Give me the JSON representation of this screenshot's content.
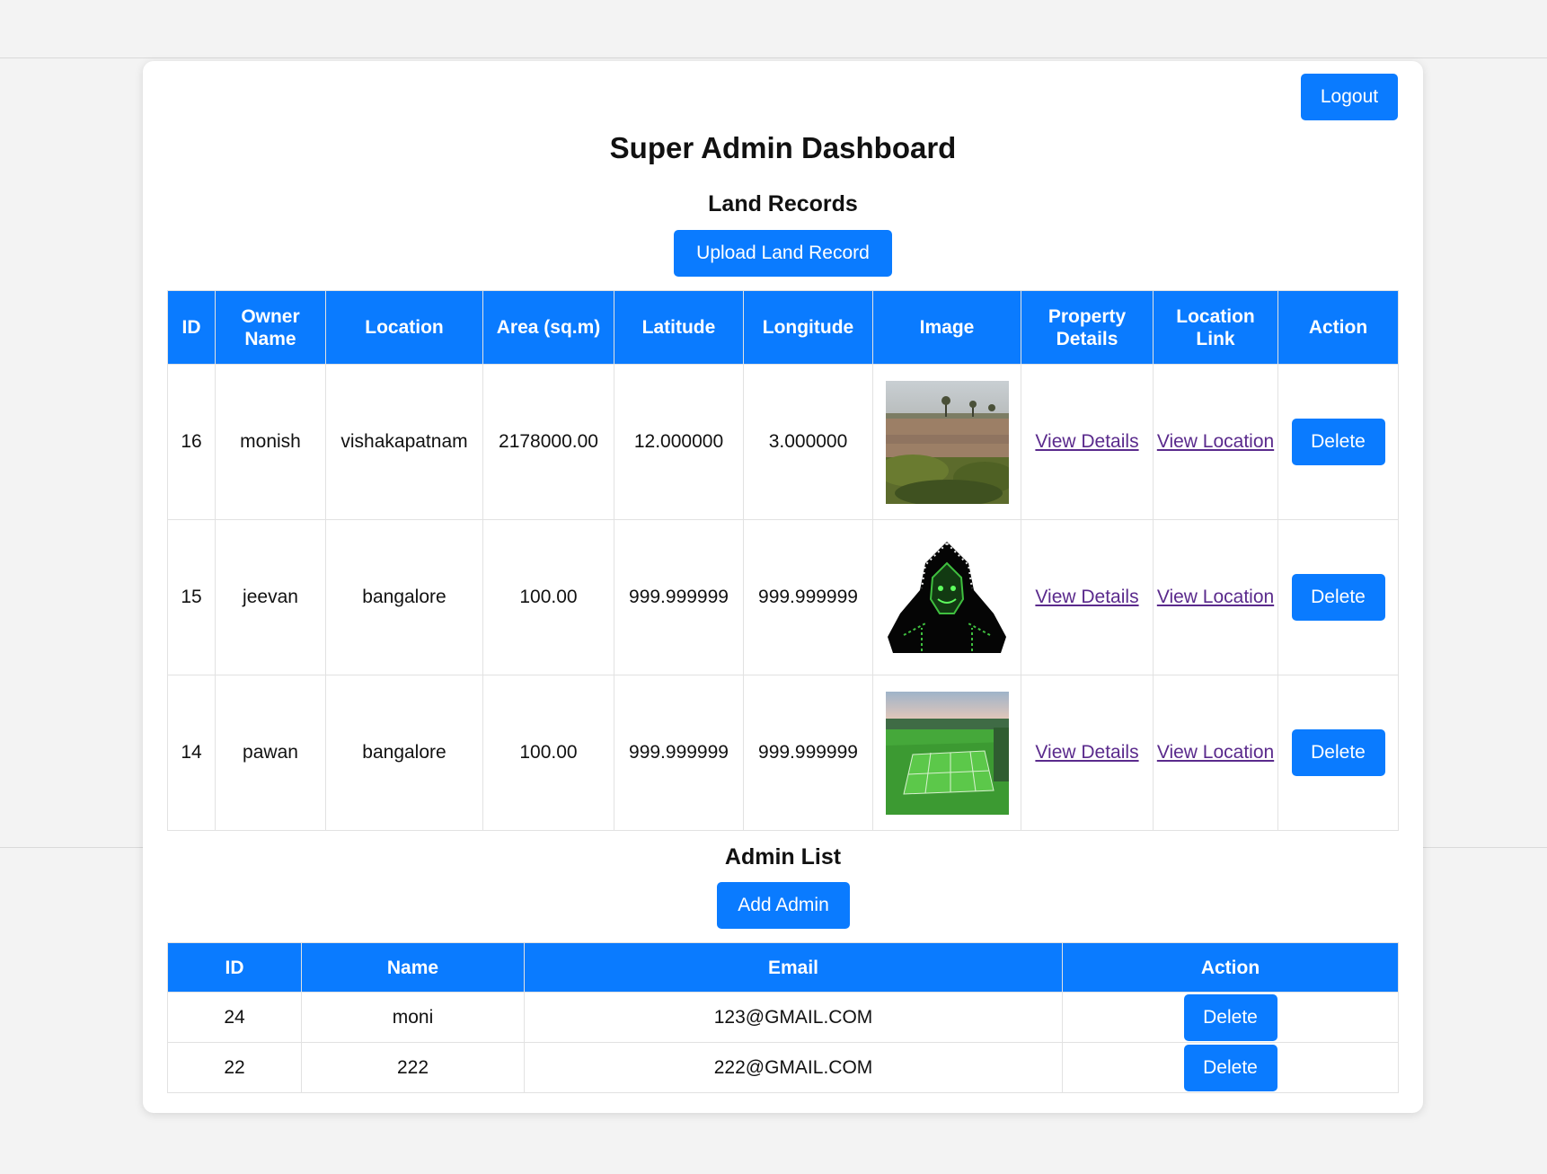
{
  "header": {
    "logout_label": "Logout"
  },
  "page_title": "Super Admin Dashboard",
  "land_records": {
    "heading": "Land Records",
    "upload_label": "Upload Land Record",
    "columns": [
      "ID",
      "Owner Name",
      "Location",
      "Area (sq.m)",
      "Latitude",
      "Longitude",
      "Image",
      "Property Details",
      "Location Link",
      "Action"
    ],
    "rows": [
      {
        "id": "16",
        "owner": "monish",
        "location": "vishakapatnam",
        "area": "2178000.00",
        "lat": "12.000000",
        "lng": "3.000000",
        "image": "dry-field-photo",
        "details_label": "View Details",
        "location_label": "View Location",
        "action_label": "Delete"
      },
      {
        "id": "15",
        "owner": "jeevan",
        "location": "bangalore",
        "area": "100.00",
        "lat": "999.999999",
        "lng": "999.999999",
        "image": "hooded-figure-icon",
        "details_label": "View Details",
        "location_label": "View Location",
        "action_label": "Delete"
      },
      {
        "id": "14",
        "owner": "pawan",
        "location": "bangalore",
        "area": "100.00",
        "lat": "999.999999",
        "lng": "999.999999",
        "image": "green-field-aerial-photo",
        "details_label": "View Details",
        "location_label": "View Location",
        "action_label": "Delete"
      }
    ]
  },
  "admin_list": {
    "heading": "Admin List",
    "add_label": "Add Admin",
    "columns": [
      "ID",
      "Name",
      "Email",
      "Action"
    ],
    "rows": [
      {
        "id": "24",
        "name": "moni",
        "email": "123@GMAIL.COM",
        "action_label": "Delete"
      },
      {
        "id": "22",
        "name": "222",
        "email": "222@GMAIL.COM",
        "action_label": "Delete"
      }
    ]
  },
  "colors": {
    "accent": "#0a7bff",
    "link": "#5a2a8c",
    "background": "#f3f3f3"
  }
}
